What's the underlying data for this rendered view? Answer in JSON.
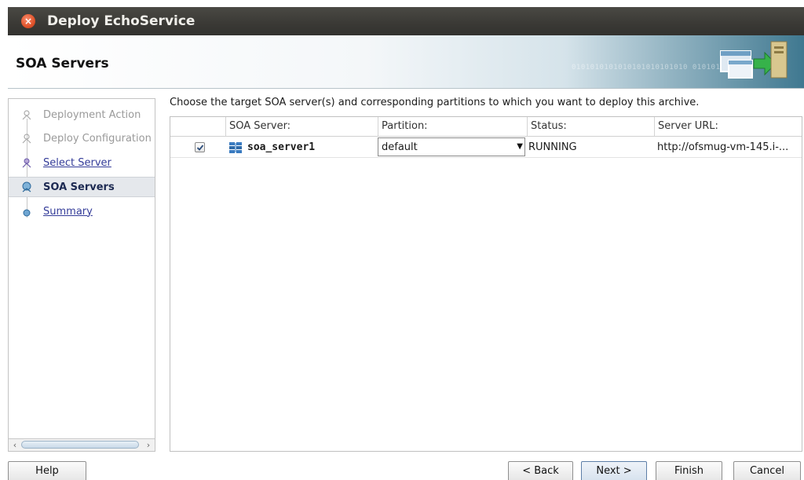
{
  "window": {
    "title": "Deploy EchoService"
  },
  "header": {
    "title": "SOA Servers",
    "decor_binary": "0101010101010101010101010 01010101010"
  },
  "nav": {
    "items": [
      {
        "label": "Deployment Action",
        "state": "disabled"
      },
      {
        "label": "Deploy Configuration",
        "state": "disabled"
      },
      {
        "label": "Select Server",
        "state": "link"
      },
      {
        "label": "SOA Servers",
        "state": "active"
      },
      {
        "label": "Summary",
        "state": "link"
      }
    ]
  },
  "main": {
    "instruction": "Choose the target SOA server(s) and corresponding partitions to which you want to deploy this archive.",
    "columns": [
      "SOA Server:",
      "Partition:",
      "Status:",
      "Server URL:"
    ],
    "rows": [
      {
        "checked": true,
        "server": "soa_server1",
        "partition": "default",
        "status": "RUNNING",
        "url": "http://ofsmug-vm-145.i-..."
      }
    ]
  },
  "buttons": {
    "help": "Help",
    "back": "< Back",
    "next": "Next >",
    "finish": "Finish",
    "cancel": "Cancel"
  },
  "colors": {
    "titlebar": "#3a3935",
    "close": "#e0532b",
    "link": "#343c99",
    "header_accent": "#3f7890"
  }
}
